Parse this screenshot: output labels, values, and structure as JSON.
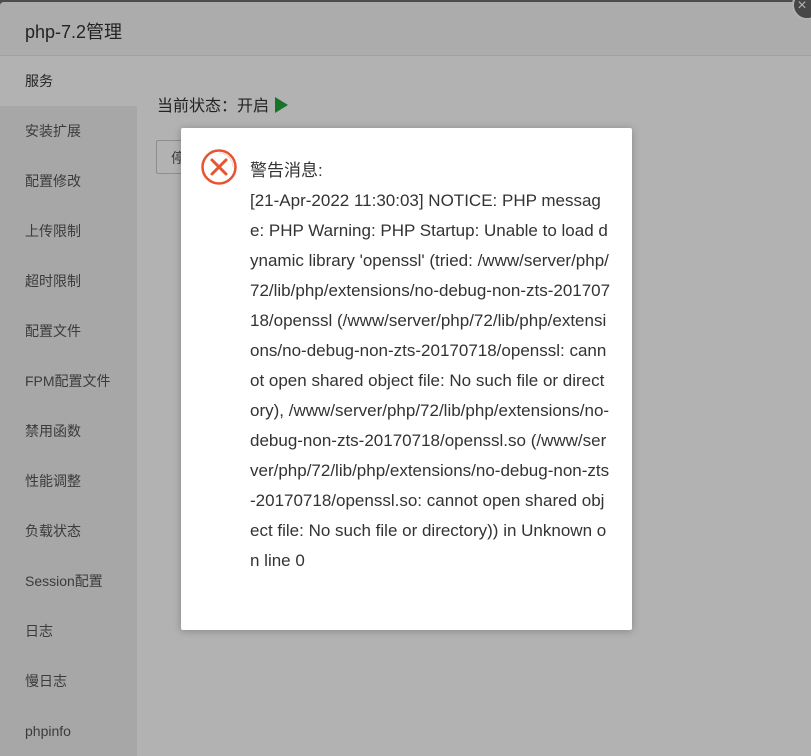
{
  "window": {
    "title": "php-7.2管理",
    "close_label": "×"
  },
  "sidebar": {
    "items": [
      {
        "label": "服务"
      },
      {
        "label": "安装扩展"
      },
      {
        "label": "配置修改"
      },
      {
        "label": "上传限制"
      },
      {
        "label": "超时限制"
      },
      {
        "label": "配置文件"
      },
      {
        "label": "FPM配置文件"
      },
      {
        "label": "禁用函数"
      },
      {
        "label": "性能调整"
      },
      {
        "label": "负载状态"
      },
      {
        "label": "Session配置"
      },
      {
        "label": "日志"
      },
      {
        "label": "慢日志"
      },
      {
        "label": "phpinfo"
      }
    ],
    "active_index": 0
  },
  "main": {
    "status_label": "当前状态：",
    "status_value": "开启",
    "stop_button_label": "停"
  },
  "dialog": {
    "icon": "error-circle-icon",
    "heading": "警告消息:",
    "message": "[21-Apr-2022 11:30:03] NOTICE: PHP message: PHP Warning: PHP Startup: Unable to load dynamic library 'openssl' (tried: /www/server/php/72/lib/php/extensions/no-debug-non-zts-20170718/openssl (/www/server/php/72/lib/php/extensions/no-debug-non-zts-20170718/openssl: cannot open shared object file: No such file or directory), /www/server/php/72/lib/php/extensions/no-debug-non-zts-20170718/openssl.so (/www/server/php/72/lib/php/extensions/no-debug-non-zts-20170718/openssl.so: cannot open shared object file: No such file or directory)) in Unknown on line 0"
  },
  "colors": {
    "accent_green": "#20a53a",
    "error_red": "#e8542f"
  }
}
